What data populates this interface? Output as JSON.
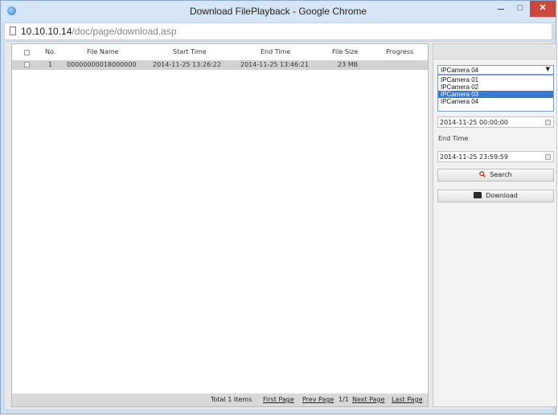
{
  "window": {
    "title": "Download FilePlayback - Google Chrome",
    "min_glyph": "–",
    "max_glyph": "□",
    "close_glyph": "✕"
  },
  "address": {
    "host": "10.10.10.14",
    "path": "/doc/page/download.asp"
  },
  "table": {
    "headers": {
      "no": "No.",
      "file_name": "File Name",
      "start_time": "Start Time",
      "end_time": "End Time",
      "file_size": "File Size",
      "progress": "Progress"
    },
    "rows": [
      {
        "no": "1",
        "file_name": "00000000018000000",
        "start_time": "2014-11-25 13:26:22",
        "end_time": "2014-11-25 13:46:21",
        "file_size": "23 MB",
        "progress": ""
      }
    ]
  },
  "pagination": {
    "total": "Total 1 Items",
    "first": "First Page",
    "prev": "Prev Page",
    "page": "1/1",
    "next": "Next Page",
    "last": "Last Page"
  },
  "side": {
    "camera_select": {
      "value": "IPCamera 04",
      "arrow": "▼",
      "options": [
        "IPCamera 01",
        "IPCamera 02",
        "IPCamera 03",
        "IPCamera 04"
      ],
      "highlighted_index": 2
    },
    "start_time_value": "2014-11-25 00:00:00",
    "end_time_label": "End Time",
    "end_time_value": "2014-11-25 23:59:59",
    "search_label": "Search",
    "download_label": "Download"
  },
  "colors": {
    "highlight": "#3679d1",
    "close_button": "#c9483e",
    "row_selected": "#d2d2d2",
    "search_icon": "#c0392b"
  },
  "icons": [
    "app-icon",
    "page-icon",
    "checkbox-icon",
    "calendar-icon",
    "search-icon",
    "download-icon"
  ]
}
